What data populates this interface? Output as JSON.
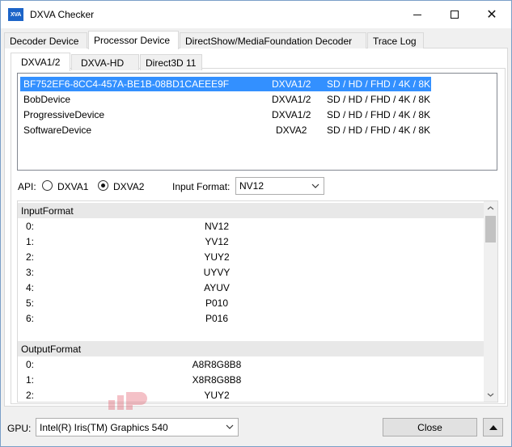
{
  "window": {
    "icon_text": "XVA",
    "title": "DXVA Checker"
  },
  "main_tabs": [
    {
      "label": "Decoder Device"
    },
    {
      "label": "Processor Device"
    },
    {
      "label": "DirectShow/MediaFoundation Decoder"
    },
    {
      "label": "Trace Log"
    }
  ],
  "sub_tabs": [
    {
      "label": "DXVA1/2"
    },
    {
      "label": "DXVA-HD"
    },
    {
      "label": "Direct3D 11"
    }
  ],
  "devices": [
    {
      "name": "BF752EF6-8CC4-457A-BE1B-08BD1CAEEE9F",
      "api": "DXVA1/2",
      "resolutions": "SD / HD / FHD / 4K / 8K"
    },
    {
      "name": "BobDevice",
      "api": "DXVA1/2",
      "resolutions": "SD / HD / FHD / 4K / 8K"
    },
    {
      "name": "ProgressiveDevice",
      "api": "DXVA1/2",
      "resolutions": "SD / HD / FHD / 4K / 8K"
    },
    {
      "name": "SoftwareDevice",
      "api": "DXVA2",
      "resolutions": "SD / HD / FHD / 4K / 8K"
    }
  ],
  "api": {
    "label": "API:",
    "option1": "DXVA1",
    "option2": "DXVA2",
    "selected": "DXVA2"
  },
  "input_format": {
    "label": "Input Format:",
    "value": "NV12"
  },
  "formats": {
    "input_header": "InputFormat",
    "input_rows": [
      {
        "index": "0:",
        "value": "NV12"
      },
      {
        "index": "1:",
        "value": "YV12"
      },
      {
        "index": "2:",
        "value": "YUY2"
      },
      {
        "index": "3:",
        "value": "UYVY"
      },
      {
        "index": "4:",
        "value": "AYUV"
      },
      {
        "index": "5:",
        "value": "P010"
      },
      {
        "index": "6:",
        "value": "P016"
      }
    ],
    "output_header": "OutputFormat",
    "output_rows": [
      {
        "index": "0:",
        "value": "A8R8G8B8"
      },
      {
        "index": "1:",
        "value": "X8R8G8B8"
      },
      {
        "index": "2:",
        "value": "YUY2"
      }
    ]
  },
  "bottom": {
    "gpu_label": "GPU:",
    "gpu_value": "Intel(R) Iris(TM) Graphics 540",
    "close_label": "Close"
  },
  "colors": {
    "selection": "#3390ff",
    "window_bg": "#f0f0f0",
    "group_header_bg": "#e8e8e8"
  }
}
